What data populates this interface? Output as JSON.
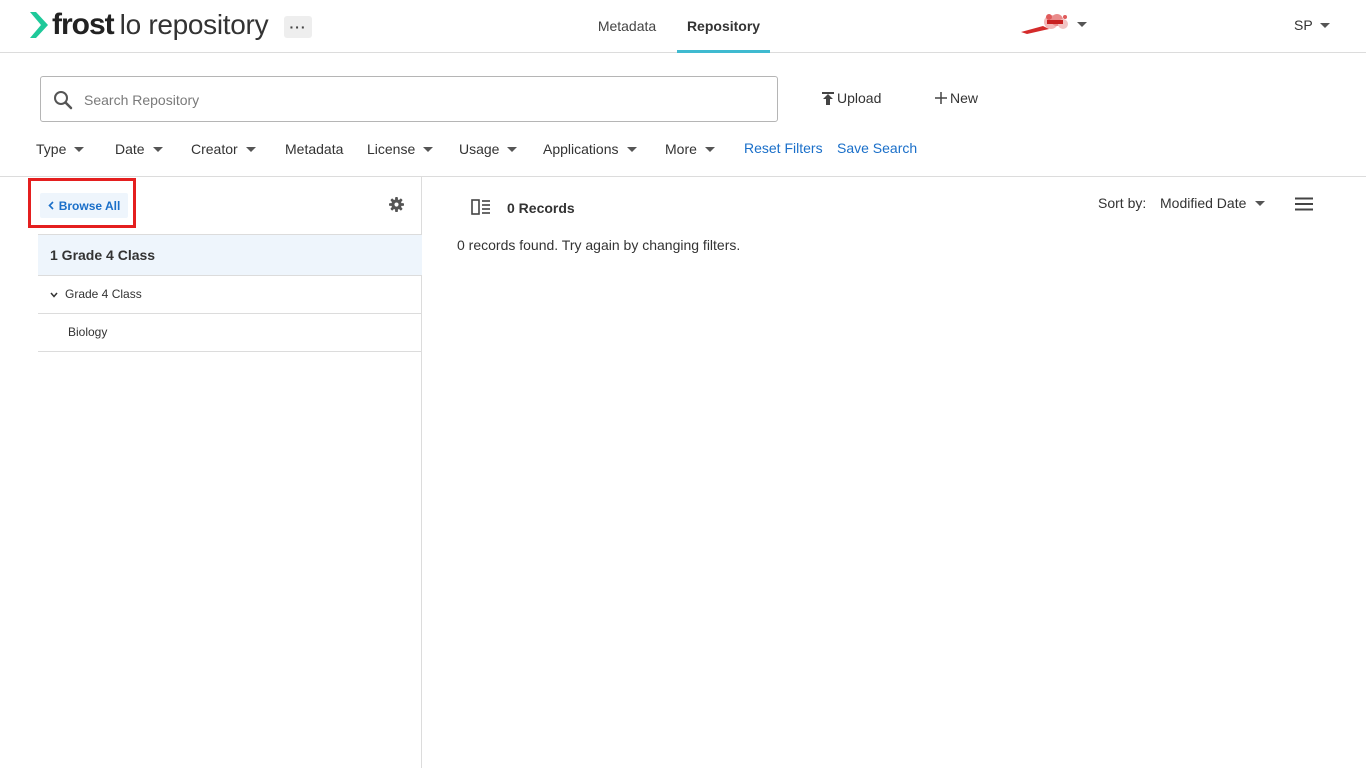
{
  "header": {
    "brand": "frost",
    "product": "lo repository",
    "more_label": "···",
    "nav": [
      {
        "label": "Metadata"
      },
      {
        "label": "Repository"
      }
    ],
    "user_initials": "SP",
    "colors": {
      "accent": "#3fbad0",
      "brand_green": "#1fc99a"
    }
  },
  "search": {
    "placeholder": "Search Repository",
    "value": ""
  },
  "actions": {
    "upload_label": "Upload",
    "new_label": "New"
  },
  "filters": {
    "items": [
      {
        "label": "Type"
      },
      {
        "label": "Date"
      },
      {
        "label": "Creator"
      },
      {
        "label": "Metadata"
      },
      {
        "label": "License"
      },
      {
        "label": "Usage"
      },
      {
        "label": "Applications"
      },
      {
        "label": "More"
      }
    ],
    "reset_label": "Reset Filters",
    "save_label": "Save Search"
  },
  "sidebar": {
    "browse_all_label": "Browse All",
    "tree_title": "1 Grade 4 Class",
    "tree_items": [
      {
        "label": "Grade 4 Class",
        "expanded": true
      },
      {
        "label": "Biology"
      }
    ]
  },
  "results": {
    "count_label": "0 Records",
    "empty_message": "0 records found. Try again by changing filters.",
    "sort_label": "Sort by:",
    "sort_value": "Modified Date"
  },
  "icons": [
    "chevron-right-logo-icon",
    "search-icon",
    "upload-icon",
    "plus-icon",
    "chevron-left-icon",
    "gear-icon",
    "split-view-icon",
    "list-menu-icon",
    "caret-down-icon"
  ]
}
